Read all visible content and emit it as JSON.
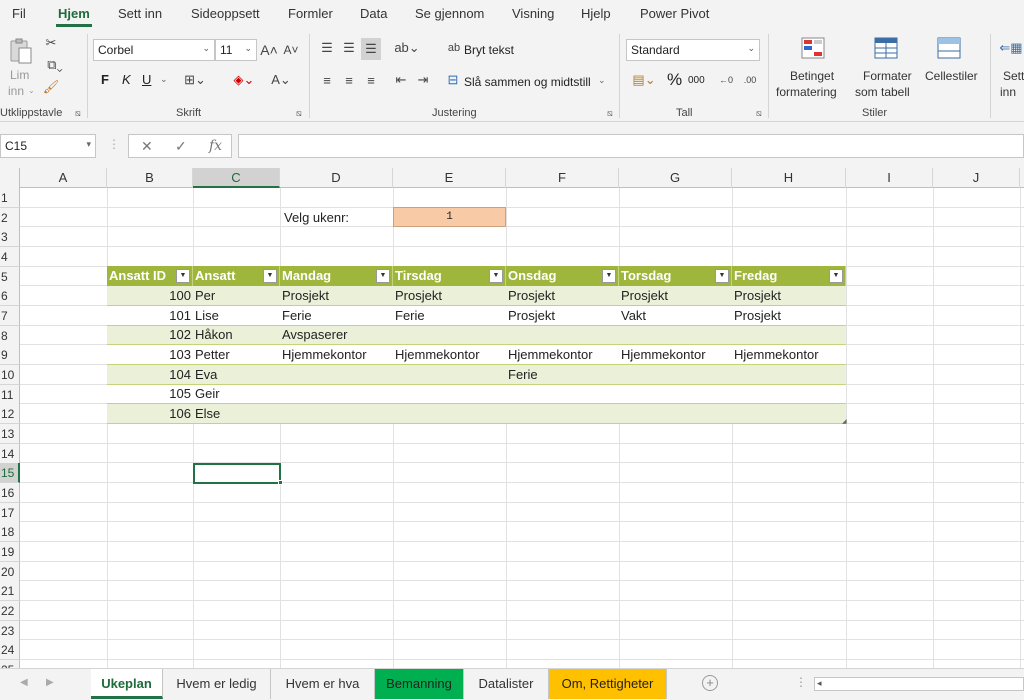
{
  "menu": {
    "tabs": [
      "Fil",
      "Hjem",
      "Sett inn",
      "Sideoppsett",
      "Formler",
      "Data",
      "Se gjennom",
      "Visning",
      "Hjelp",
      "Power Pivot"
    ],
    "active": "Hjem"
  },
  "ribbon": {
    "clipboard": {
      "paste_label_1": "Lim",
      "paste_label_2": "inn",
      "group": "Utklippstavle"
    },
    "font": {
      "name": "Corbel",
      "size": "11",
      "bold": "F",
      "italic": "K",
      "underline": "U",
      "group": "Skrift"
    },
    "alignment": {
      "wrap_text": "Bryt tekst",
      "merge_center": "Slå sammen og midtstill",
      "group": "Justering"
    },
    "number": {
      "format": "Standard",
      "percent": "%",
      "thousands": "000",
      "group": "Tall"
    },
    "styles": {
      "conditional_1": "Betinget",
      "conditional_2": "formatering",
      "format_table_1": "Formater",
      "format_table_2": "som tabell",
      "cell_styles": "Cellestiler",
      "group": "Stiler"
    },
    "cells": {
      "insert_1": "Sett",
      "insert_2": "inn"
    }
  },
  "formula_bar": {
    "name_box": "C15",
    "formula": ""
  },
  "columns": [
    "A",
    "B",
    "C",
    "D",
    "E",
    "F",
    "G",
    "H",
    "I",
    "J"
  ],
  "selected_column": "C",
  "rows": [
    "1",
    "2",
    "3",
    "4",
    "5",
    "6",
    "7",
    "8",
    "9",
    "10",
    "11",
    "12",
    "13",
    "14",
    "15",
    "16",
    "17",
    "18",
    "19",
    "20",
    "21",
    "22",
    "23",
    "24",
    "25"
  ],
  "selected_row": "15",
  "sheet": {
    "week_label": "Velg ukenr:",
    "week_value": "1",
    "table_headers": [
      "Ansatt ID",
      "Ansatt",
      "Mandag",
      "Tirsdag",
      "Onsdag",
      "Torsdag",
      "Fredag"
    ],
    "table_rows": [
      {
        "id": "100",
        "name": "Per",
        "mon": "Prosjekt",
        "tue": "Prosjekt",
        "wed": "Prosjekt",
        "thu": "Prosjekt",
        "fri": "Prosjekt"
      },
      {
        "id": "101",
        "name": "Lise",
        "mon": "Ferie",
        "tue": "Ferie",
        "wed": "Prosjekt",
        "thu": "Vakt",
        "fri": "Prosjekt"
      },
      {
        "id": "102",
        "name": "Håkon",
        "mon": "Avspaserer",
        "tue": "",
        "wed": "",
        "thu": "",
        "fri": ""
      },
      {
        "id": "103",
        "name": "Petter",
        "mon": "Hjemmekontor",
        "tue": "Hjemmekontor",
        "wed": "Hjemmekontor",
        "thu": "Hjemmekontor",
        "fri": "Hjemmekontor"
      },
      {
        "id": "104",
        "name": "Eva",
        "mon": "",
        "tue": "",
        "wed": "Ferie",
        "thu": "",
        "fri": ""
      },
      {
        "id": "105",
        "name": "Geir",
        "mon": "",
        "tue": "",
        "wed": "",
        "thu": "",
        "fri": ""
      },
      {
        "id": "106",
        "name": "Else",
        "mon": "",
        "tue": "",
        "wed": "",
        "thu": "",
        "fri": ""
      }
    ]
  },
  "sheet_tabs": [
    {
      "label": "Ukeplan",
      "active": true,
      "color": ""
    },
    {
      "label": "Hvem er ledig",
      "active": false,
      "color": ""
    },
    {
      "label": "Hvem er hva",
      "active": false,
      "color": ""
    },
    {
      "label": "Bemanning",
      "active": false,
      "color": "#00b050"
    },
    {
      "label": "Datalister",
      "active": false,
      "color": ""
    },
    {
      "label": "Om, Rettigheter",
      "active": false,
      "color": "#ffc000"
    }
  ],
  "colors": {
    "accent": "#217346",
    "table_header": "#9fb63d",
    "band": "#ebf1d8",
    "input_cell": "#f8cba6"
  }
}
